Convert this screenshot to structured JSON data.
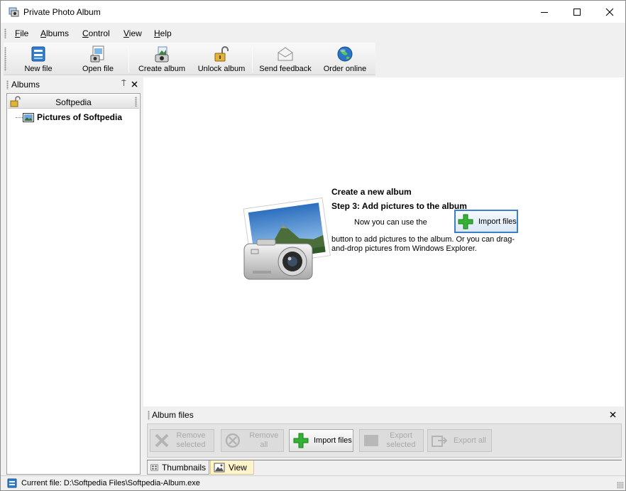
{
  "window": {
    "title": "Private Photo Album"
  },
  "menu": {
    "items": [
      {
        "label": "File",
        "accel": "F",
        "rest": "ile"
      },
      {
        "label": "Albums",
        "accel": "A",
        "rest": "lbums"
      },
      {
        "label": "Control",
        "accel": "C",
        "rest": "ontrol"
      },
      {
        "label": "View",
        "accel": "V",
        "rest": "iew"
      },
      {
        "label": "Help",
        "accel": "H",
        "rest": "elp"
      }
    ]
  },
  "toolbar": {
    "new_file": "New file",
    "open_file": "Open file",
    "create_album": "Create album",
    "unlock_album": "Unlock album",
    "send_feedback": "Send feedback",
    "order_online": "Order online"
  },
  "albums_panel": {
    "title": "Albums",
    "pin_glyph": "⍑",
    "album_name": "Softpedia",
    "tree_item": "Pictures of Softpedia"
  },
  "guide": {
    "heading": "Create a new album",
    "step": "Step 3: Add pictures to the album",
    "now_text": "Now you can use the",
    "import_label": "Import files",
    "desc": "button to add pictures to the album. Or you can drag-and-drop pictures from Windows Explorer."
  },
  "album_files": {
    "title": "Album files",
    "remove_selected_1": "Remove",
    "remove_selected_2": "selected",
    "remove_all": "Remove all",
    "import_files": "Import files",
    "export_selected_1": "Export",
    "export_selected_2": "selected",
    "export_all": "Export all"
  },
  "tabs": {
    "thumbnails": "Thumbnails",
    "view": "View"
  },
  "status": {
    "current_file": "Current file: D:\\Softpedia Files\\Softpedia-Album.exe"
  },
  "colors": {
    "accent_blue": "#3a80c8",
    "plus_green": "#34b233",
    "view_tab_bg": "#fff4cc"
  }
}
